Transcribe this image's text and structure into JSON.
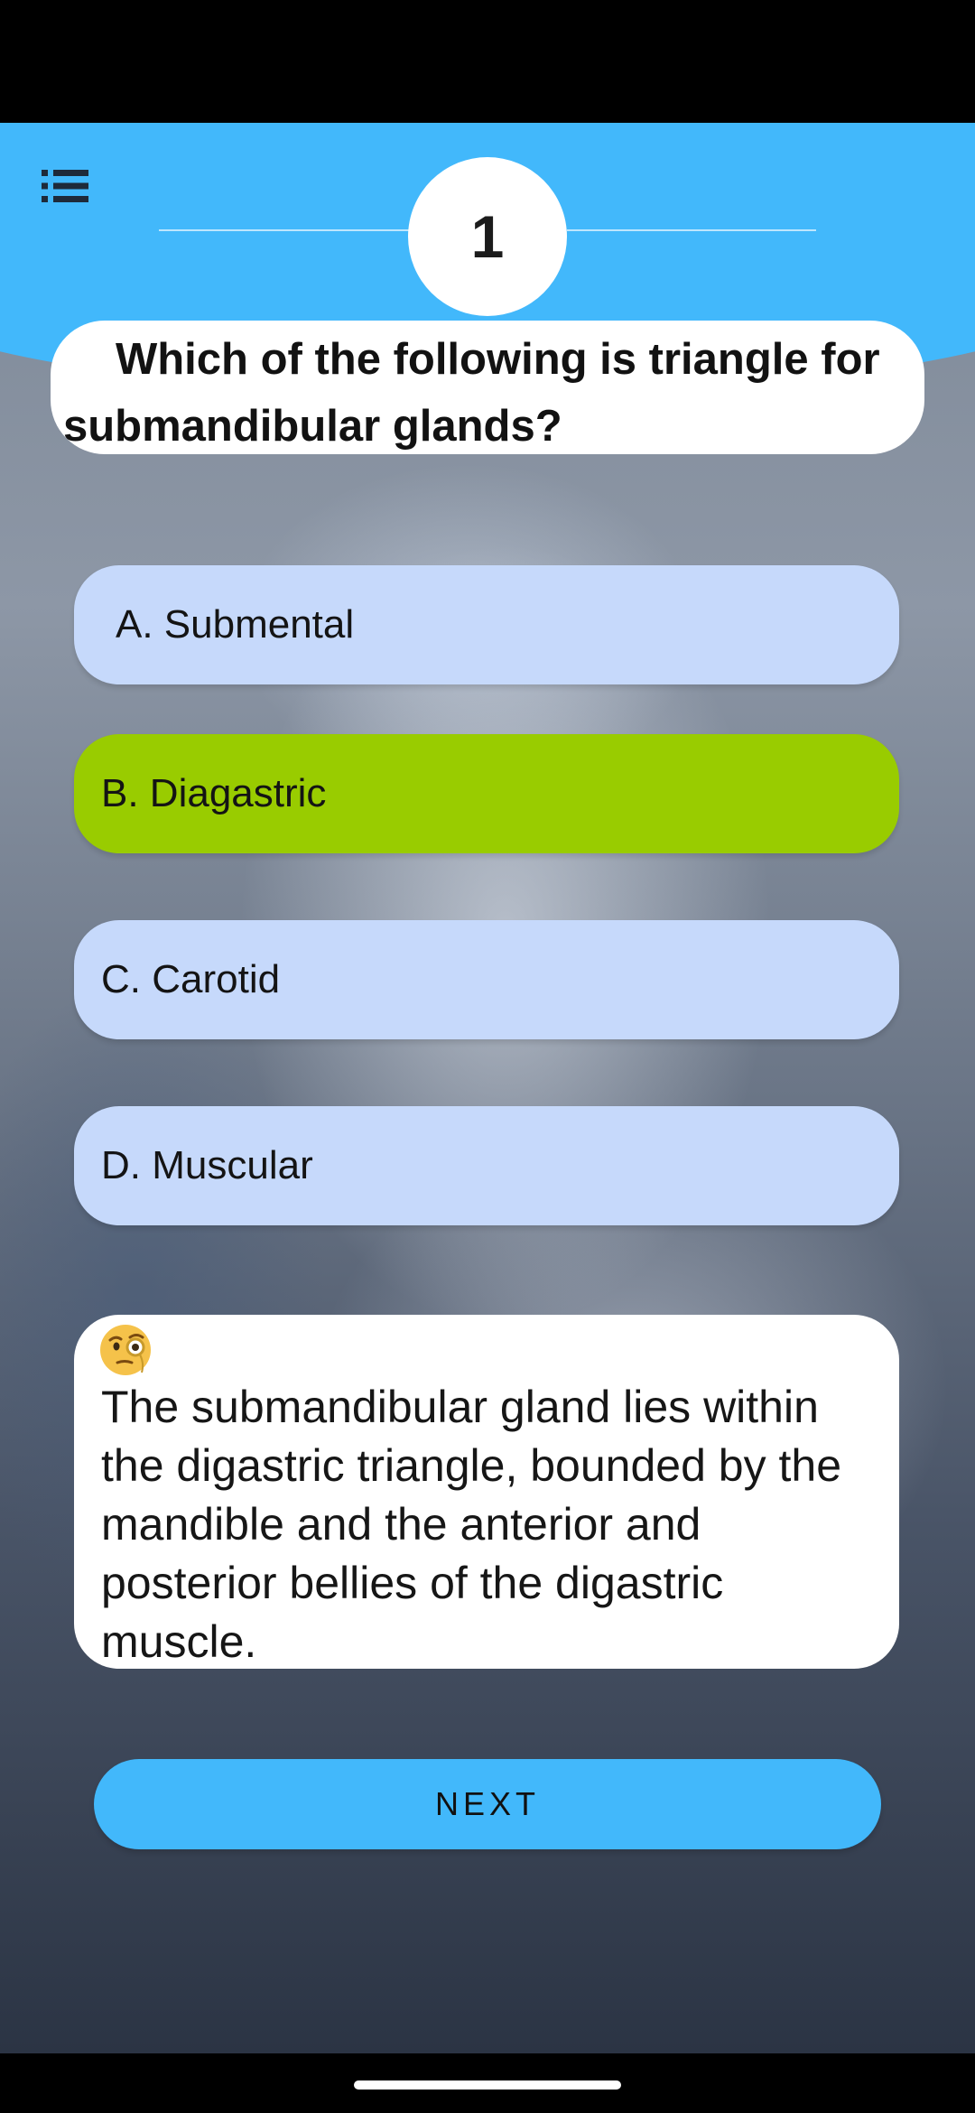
{
  "quiz": {
    "question_number": "1",
    "question": "Which of the following is triangle for submandibular glands?",
    "options": [
      {
        "label": "A. Submental",
        "state": "default"
      },
      {
        "label": "B. Diagastric",
        "state": "correct"
      },
      {
        "label": "C. Carotid",
        "state": "default"
      },
      {
        "label": "D. Muscular",
        "state": "default"
      }
    ],
    "explanation_icon": "monocle-face-emoji",
    "explanation": "The submandibular gland lies within the digastric triangle, bounded by the mandible and the anterior and posterior bellies of the digastric muscle.",
    "next_label": "NEXT"
  },
  "header": {
    "menu_icon": "list-menu-icon"
  },
  "colors": {
    "header": "#42b8fb",
    "option_default": "#c6d9fb",
    "option_correct": "#99cc00",
    "card": "#ffffff",
    "next_button": "#42b8fb"
  }
}
